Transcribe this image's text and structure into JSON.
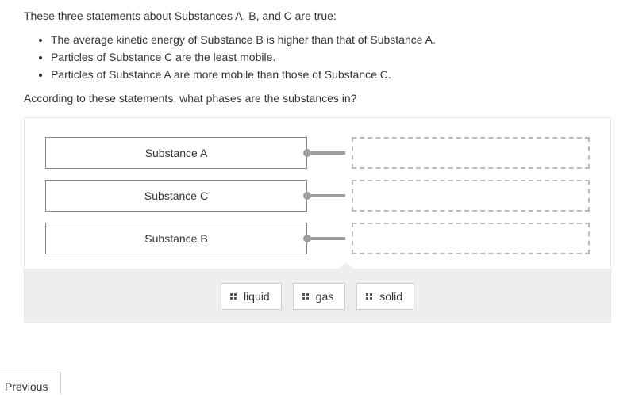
{
  "intro": "These three statements about Substances A, B, and C are true:",
  "bullets": [
    "The average kinetic energy of Substance B is higher than that of Substance A.",
    "Particles of Substance C are the least mobile.",
    "Particles of Substance A are more mobile than those of Substance C."
  ],
  "prompt": "According to these statements, what phases are the substances in?",
  "rows": [
    {
      "label": "Substance A"
    },
    {
      "label": "Substance C"
    },
    {
      "label": "Substance B"
    }
  ],
  "choices": [
    {
      "label": "liquid"
    },
    {
      "label": "gas"
    },
    {
      "label": "solid"
    }
  ],
  "prev_label": "Previous"
}
